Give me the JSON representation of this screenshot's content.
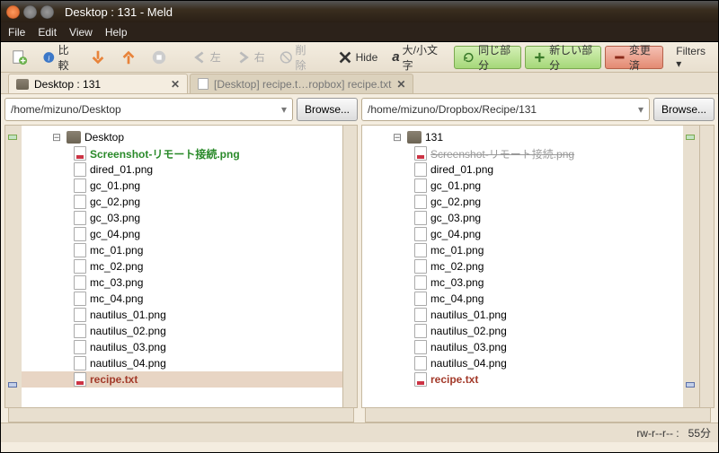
{
  "window": {
    "title": "Desktop : 131 - Meld"
  },
  "menus": [
    "File",
    "Edit",
    "View",
    "Help"
  ],
  "toolbar": {
    "compare": "比較",
    "left": "左",
    "right": "右",
    "delete": "削除",
    "hide": "Hide",
    "case": "大/小文字",
    "same": "同じ部分",
    "new": "新しい部分",
    "changed": "変更済",
    "filters": "Filters ▾"
  },
  "tabs": [
    {
      "label": "Desktop : 131",
      "active": true
    },
    {
      "label": "[Desktop] recipe.t…ropbox] recipe.txt",
      "active": false
    }
  ],
  "left": {
    "path": "/home/mizuno/Desktop",
    "browse": "Browse...",
    "root": "Desktop",
    "files": [
      {
        "name": "Screenshot-リモート接続.png",
        "style": "green"
      },
      {
        "name": "dired_01.png",
        "style": ""
      },
      {
        "name": "gc_01.png",
        "style": ""
      },
      {
        "name": "gc_02.png",
        "style": ""
      },
      {
        "name": "gc_03.png",
        "style": ""
      },
      {
        "name": "gc_04.png",
        "style": ""
      },
      {
        "name": "mc_01.png",
        "style": ""
      },
      {
        "name": "mc_02.png",
        "style": ""
      },
      {
        "name": "mc_03.png",
        "style": ""
      },
      {
        "name": "mc_04.png",
        "style": ""
      },
      {
        "name": "nautilus_01.png",
        "style": ""
      },
      {
        "name": "nautilus_02.png",
        "style": ""
      },
      {
        "name": "nautilus_03.png",
        "style": ""
      },
      {
        "name": "nautilus_04.png",
        "style": ""
      },
      {
        "name": "recipe.txt",
        "style": "redbold hl"
      }
    ]
  },
  "right": {
    "path": "/home/mizuno/Dropbox/Recipe/131",
    "browse": "Browse...",
    "root": "131",
    "files": [
      {
        "name": "Screenshot-リモート接続.png",
        "style": "strike"
      },
      {
        "name": "dired_01.png",
        "style": ""
      },
      {
        "name": "gc_01.png",
        "style": ""
      },
      {
        "name": "gc_02.png",
        "style": ""
      },
      {
        "name": "gc_03.png",
        "style": ""
      },
      {
        "name": "gc_04.png",
        "style": ""
      },
      {
        "name": "mc_01.png",
        "style": ""
      },
      {
        "name": "mc_02.png",
        "style": ""
      },
      {
        "name": "mc_03.png",
        "style": ""
      },
      {
        "name": "mc_04.png",
        "style": ""
      },
      {
        "name": "nautilus_01.png",
        "style": ""
      },
      {
        "name": "nautilus_02.png",
        "style": ""
      },
      {
        "name": "nautilus_03.png",
        "style": ""
      },
      {
        "name": "nautilus_04.png",
        "style": ""
      },
      {
        "name": "recipe.txt",
        "style": "redbold"
      }
    ]
  },
  "status": {
    "perms": "rw-r--r-- :",
    "time": "55分"
  },
  "glyphs": {
    "expand_minus": "⊟",
    "tab_close": "✕",
    "dropdown": "▾"
  }
}
